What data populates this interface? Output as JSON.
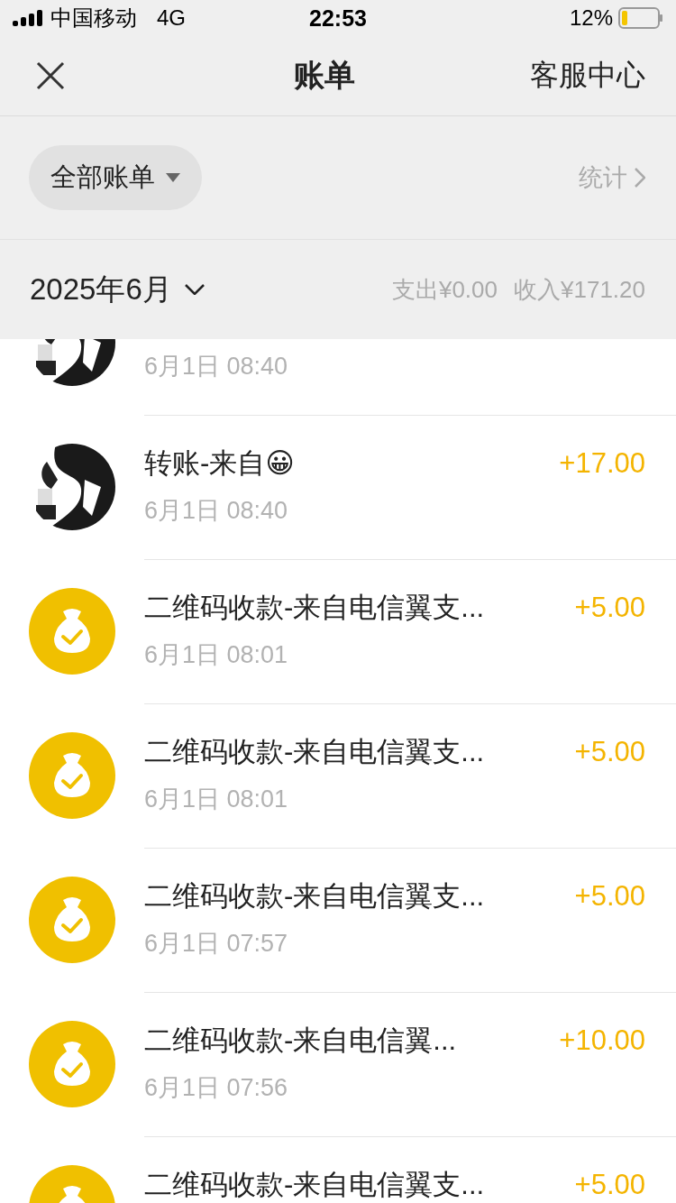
{
  "status_bar": {
    "carrier": "中国移动",
    "network": "4G",
    "time": "22:53",
    "battery": "12%"
  },
  "nav": {
    "title": "账单",
    "right": "客服中心"
  },
  "filter": {
    "label": "全部账单",
    "stats": "统计"
  },
  "month": {
    "label": "2025年6月",
    "expense": "支出¥0.00",
    "income": "收入¥171.20"
  },
  "rows": [
    {
      "kind": "transfer",
      "time": "6月1日 08:40"
    },
    {
      "kind": "transfer",
      "title": "转账-来自😀",
      "time": "6月1日 08:40",
      "amount": "+17.00"
    },
    {
      "kind": "qr_payment",
      "title": "二维码收款-来自电信翼支...",
      "time": "6月1日 08:01",
      "amount": "+5.00"
    },
    {
      "kind": "qr_payment",
      "title": "二维码收款-来自电信翼支...",
      "time": "6月1日 08:01",
      "amount": "+5.00"
    },
    {
      "kind": "qr_payment",
      "title": "二维码收款-来自电信翼支...",
      "time": "6月1日 07:57",
      "amount": "+5.00"
    },
    {
      "kind": "qr_payment",
      "title": "二维码收款-来自电信翼...",
      "time": "6月1日 07:56",
      "amount": "+10.00"
    },
    {
      "kind": "qr_payment",
      "title": "二维码收款-来自电信翼支...",
      "amount": "+5.00"
    }
  ]
}
